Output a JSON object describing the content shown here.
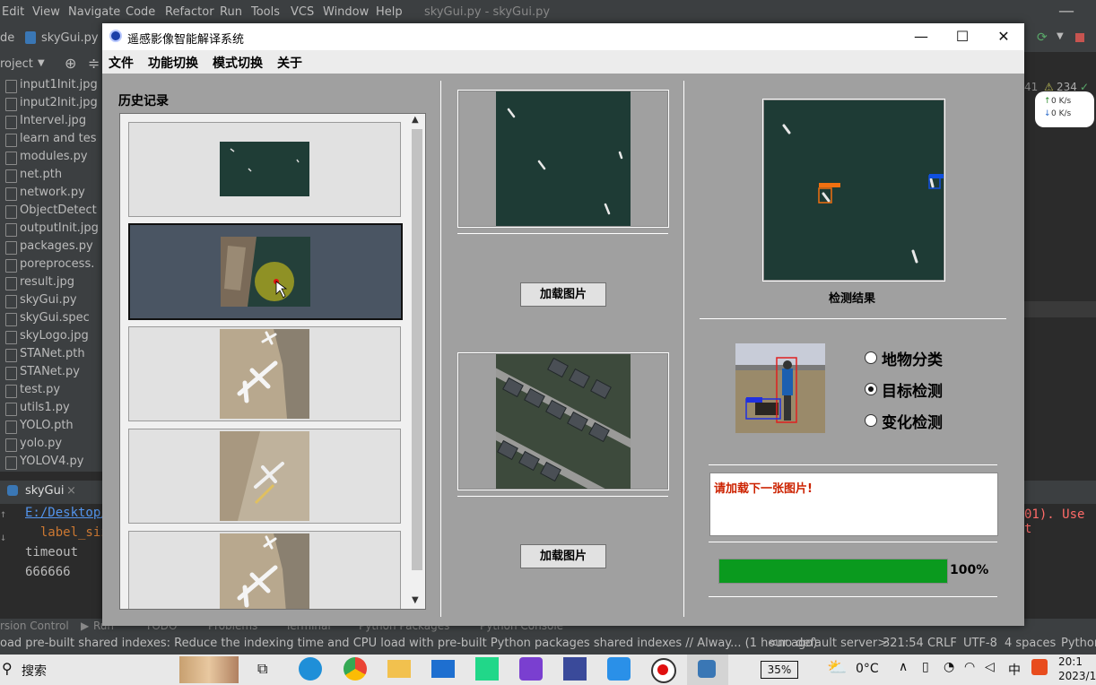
{
  "ide": {
    "menu": [
      "Edit",
      "View",
      "Navigate",
      "Code",
      "Refactor",
      "Run",
      "Tools",
      "VCS",
      "Window",
      "Help"
    ],
    "window_title": "skyGui.py - skyGui.py",
    "tab_file": "skyGui.py",
    "tab_prefix": "de",
    "project_label": "roject",
    "files": [
      "input1Init.jpg",
      "input2Init.jpg",
      "Intervel.jpg",
      "learn and tes",
      "modules.py",
      "net.pth",
      "network.py",
      "ObjectDetect",
      "outputInit.jpg",
      "packages.py",
      "poreprocess.",
      "result.jpg",
      "skyGui.py",
      "skyGui.spec",
      "skyLogo.jpg",
      "STANet.pth",
      "STANet.py",
      "test.py",
      "utils1.py",
      "YOLO.pth",
      "yolo.py",
      "YOLOV4.py"
    ],
    "run_tab": "skyGui",
    "console_lines": [
      "E:/Desktop/",
      "  label_siz",
      "timeout",
      "666666"
    ],
    "console_right": "01). Use t",
    "warning_count": "234",
    "line_num_partial": "41",
    "net_up": "0  K/s",
    "net_down": "0  K/s",
    "toolwindow_tabs": [
      "rsion Control",
      "Run",
      "TODO",
      "Problems",
      "Terminal",
      "Python Packages",
      "Python Console"
    ],
    "status_message": "oad pre-built shared indexes: Reduce the indexing time and CPU load with pre-built Python packages shared indexes // Alway... (1 hour ago)",
    "status_right": [
      "<no default server>",
      "321:54",
      "CRLF",
      "UTF-8",
      "4 spaces",
      "Python"
    ]
  },
  "taskbar": {
    "search": "搜索",
    "battery": "35%",
    "temperature": "0°C",
    "ime": "中",
    "time": "20:1",
    "date": "2023/1"
  },
  "app": {
    "title": "遥感影像智能解译系统",
    "menu": [
      "文件",
      "功能切换",
      "模式切换",
      "关于"
    ],
    "history_title": "历史记录",
    "load_button_1": "加载图片",
    "load_button_2": "加载图片",
    "result_caption": "检测结果",
    "modes": [
      {
        "label": "地物分类",
        "selected": false
      },
      {
        "label": "目标检测",
        "selected": true
      },
      {
        "label": "变化检测",
        "selected": false
      }
    ],
    "message": "请加载下一张图片!",
    "message_color": "#cc2200",
    "progress": 100,
    "progress_text": "100%",
    "progress_color": "#0a9a1e"
  }
}
